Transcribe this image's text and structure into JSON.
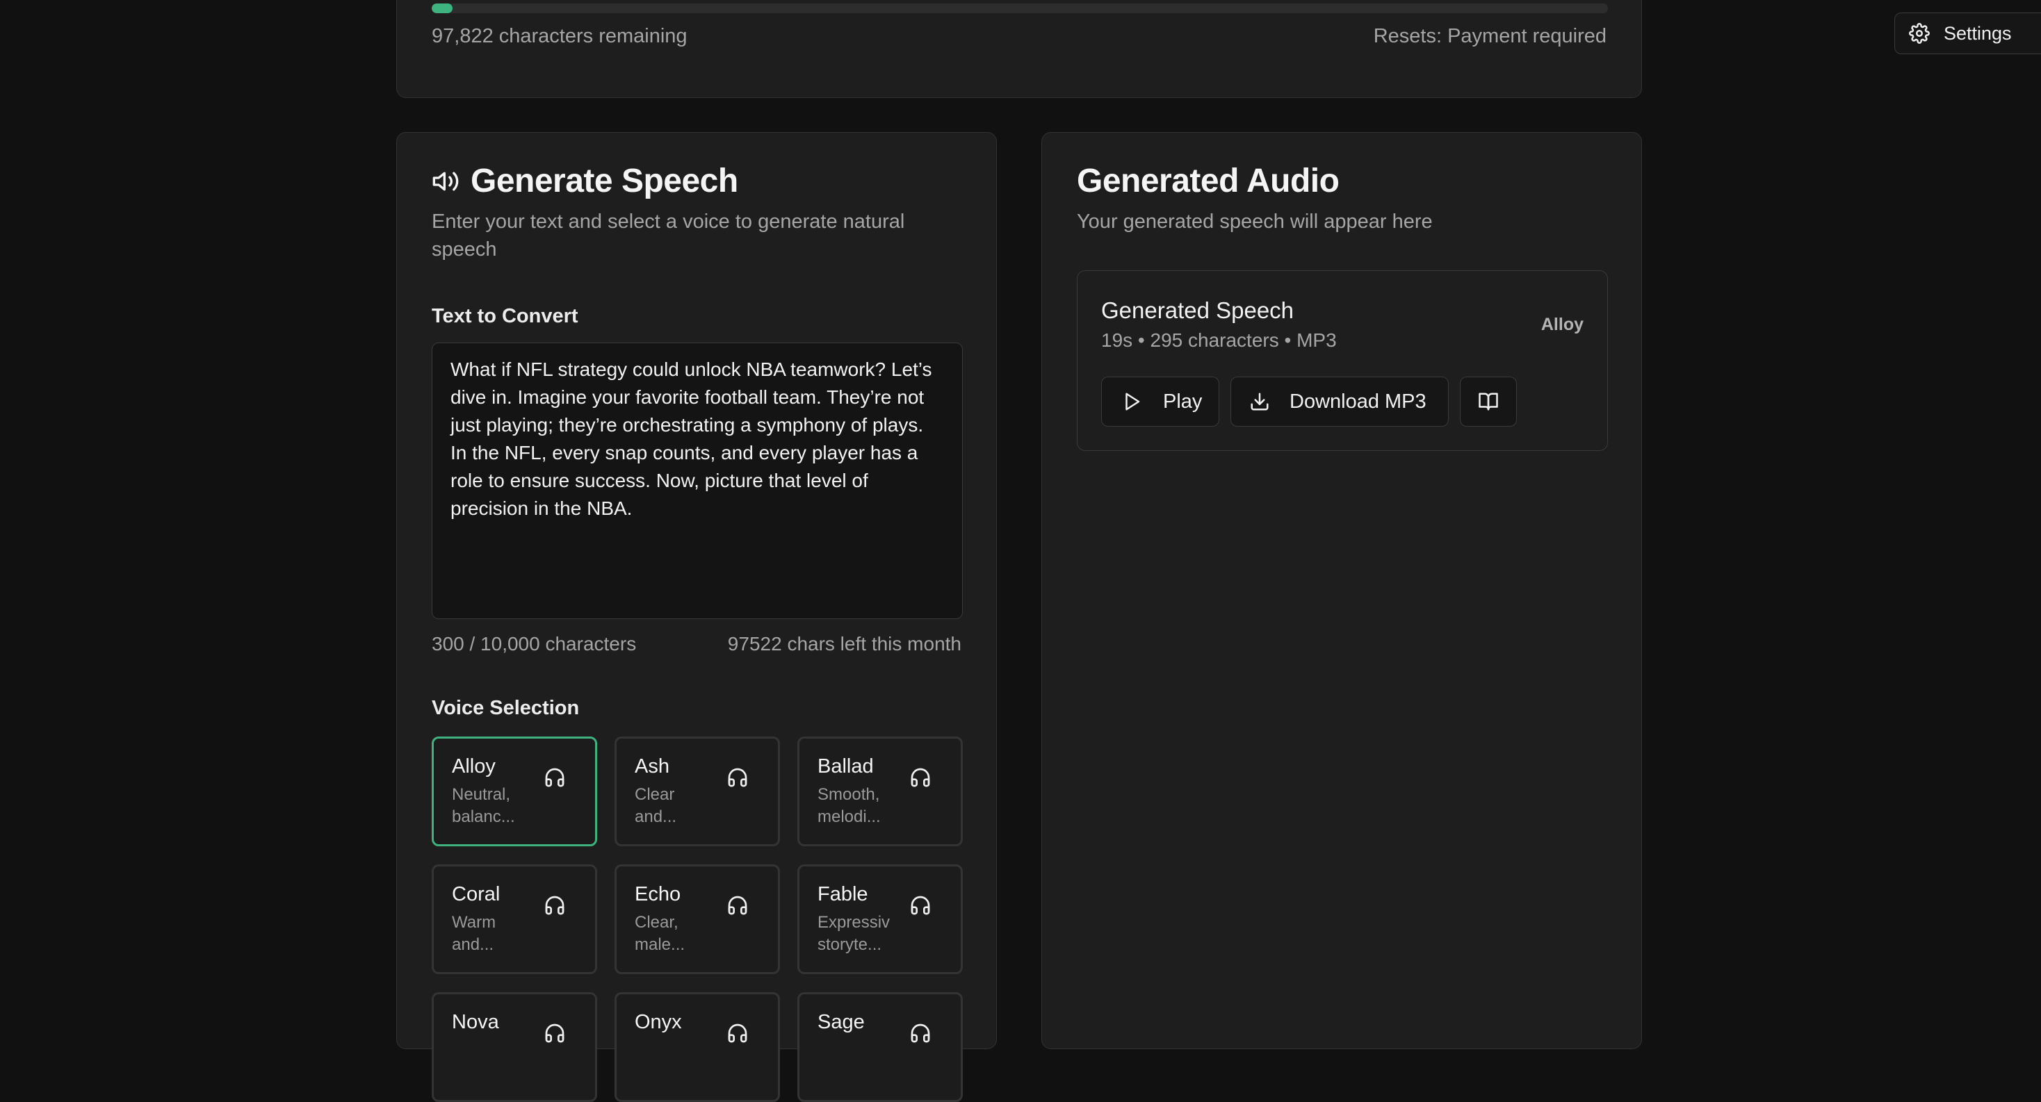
{
  "header": {
    "settings_label": "Settings",
    "settings_icon": "gear-icon"
  },
  "usage": {
    "progress_fraction": 0.018,
    "progress_color": "#3fb37f",
    "remaining_text": "97,822 characters remaining",
    "resets_text": "Resets: Payment required"
  },
  "generate": {
    "icon": "speaker-icon",
    "title": "Generate Speech",
    "subtitle": "Enter your text and select a voice to generate natural speech",
    "text_label": "Text to Convert",
    "text_value": "What if NFL strategy could unlock NBA teamwork? Let’s dive in. Imagine your favorite football team. They’re not just playing; they’re orchestrating a symphony of plays. In the NFL, every snap counts, and every player has a role to ensure success. Now, picture that level of precision in the NBA.",
    "char_count": "300 / 10,000 characters",
    "chars_left": "97522 chars left this month",
    "voice_label": "Voice Selection",
    "voices": [
      {
        "name": "Alloy",
        "desc": "Neutral,\nbalanc...",
        "selected": true
      },
      {
        "name": "Ash",
        "desc": "Clear\nand...",
        "selected": false
      },
      {
        "name": "Ballad",
        "desc": "Smooth,\nmelodi...",
        "selected": false
      },
      {
        "name": "Coral",
        "desc": "Warm\nand...",
        "selected": false
      },
      {
        "name": "Echo",
        "desc": "Clear,\nmale...",
        "selected": false
      },
      {
        "name": "Fable",
        "desc": "Expressiv\nstoryte...",
        "selected": false
      },
      {
        "name": "Nova",
        "desc": "",
        "selected": false
      },
      {
        "name": "Onyx",
        "desc": "",
        "selected": false
      },
      {
        "name": "Sage",
        "desc": "",
        "selected": false
      }
    ]
  },
  "audio": {
    "title": "Generated Audio",
    "subtitle": "Your generated speech will appear here",
    "item": {
      "title": "Generated Speech",
      "meta": "19s • 295 characters • MP3",
      "voice": "Alloy",
      "play_label": "Play",
      "download_label": "Download MP3"
    }
  }
}
